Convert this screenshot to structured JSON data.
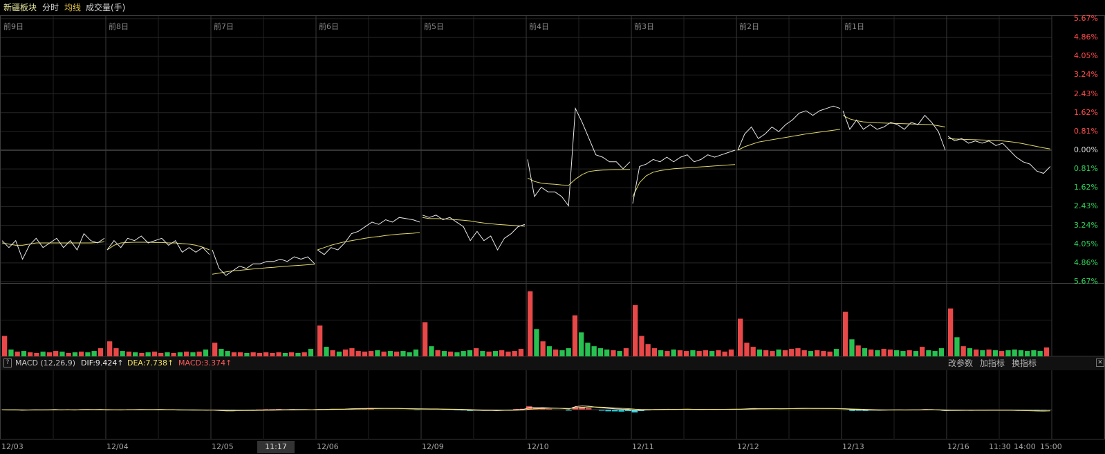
{
  "toolbar": {
    "title": "新疆板块",
    "tab_intraday": "分时",
    "tab_avg": "均线",
    "tab_volume": "成交量(手)"
  },
  "colors": {
    "up": "#ff4b4b",
    "down": "#2fd05a",
    "price_line": "#e8e8e8",
    "avg_line": "#e0d86a",
    "macd_pos": "#ff5a5a",
    "macd_neg": "#22e0f0",
    "dif": "#e8e8e8",
    "dea": "#f0e060"
  },
  "day_labels": [
    "前9日",
    "前8日",
    "前7日",
    "前6日",
    "前5日",
    "前4日",
    "前3日",
    "前2日",
    "前1日"
  ],
  "pct_axis": [
    {
      "label": "5.67%",
      "kind": "up"
    },
    {
      "label": "4.86%",
      "kind": "up"
    },
    {
      "label": "4.05%",
      "kind": "up"
    },
    {
      "label": "3.24%",
      "kind": "up"
    },
    {
      "label": "2.43%",
      "kind": "up"
    },
    {
      "label": "1.62%",
      "kind": "up"
    },
    {
      "label": "0.81%",
      "kind": "up"
    },
    {
      "label": "0.00%",
      "kind": "zero"
    },
    {
      "label": "0.81%",
      "kind": "down"
    },
    {
      "label": "1.62%",
      "kind": "down"
    },
    {
      "label": "2.43%",
      "kind": "down"
    },
    {
      "label": "3.24%",
      "kind": "down"
    },
    {
      "label": "4.05%",
      "kind": "down"
    },
    {
      "label": "4.86%",
      "kind": "down"
    },
    {
      "label": "5.67%",
      "kind": "down"
    }
  ],
  "macd": {
    "name": "MACD (12,26,9)",
    "dif": "DIF:9.424↑",
    "dea": "DEA:7.738↑",
    "macd": "MACD:3.374↑",
    "buttons": [
      "改参数",
      "加指标",
      "换指标"
    ],
    "close_symbol": "✕",
    "help_symbol": "?"
  },
  "time_axis": {
    "dates": [
      "12/03",
      "12/04",
      "12/05",
      "12/06",
      "12/09",
      "12/10",
      "12/11",
      "12/12",
      "12/13",
      "12/16"
    ],
    "tail": [
      "11:30",
      "14:00",
      "15:00"
    ],
    "cursor": "11:17"
  },
  "chart_data": {
    "type": "line",
    "x": [
      "12/03",
      "12/04",
      "12/05",
      "12/06",
      "12/09",
      "12/10",
      "12/11",
      "12/12",
      "12/13",
      "12/16"
    ],
    "y_unit": "% change vs previous close",
    "ylim": [
      -5.67,
      5.67
    ],
    "series": [
      {
        "day": "12/03",
        "price": [
          -3.9,
          -4.2,
          -3.9,
          -4.7,
          -4.1,
          -3.8,
          -4.2,
          -4.0,
          -3.8,
          -4.2,
          -3.9,
          -4.3,
          -3.6,
          -3.9,
          -4.0,
          -3.8
        ],
        "avg": [
          -4.0,
          -4.05,
          -4.1,
          -4.1,
          -4.05,
          -4.0,
          -4.0,
          -4.0,
          -4.0,
          -4.0,
          -4.0,
          -4.0,
          -4.0,
          -4.0,
          -3.98,
          -3.95
        ]
      },
      {
        "day": "12/04",
        "price": [
          -4.3,
          -3.9,
          -4.2,
          -3.8,
          -3.9,
          -3.7,
          -4.0,
          -3.9,
          -3.8,
          -4.1,
          -3.9,
          -4.4,
          -4.2,
          -4.4,
          -4.2,
          -4.5
        ],
        "avg": [
          -4.3,
          -4.1,
          -4.0,
          -3.98,
          -3.97,
          -3.97,
          -3.97,
          -3.98,
          -3.98,
          -4.0,
          -4.0,
          -4.03,
          -4.05,
          -4.1,
          -4.18,
          -4.3
        ]
      },
      {
        "day": "12/05",
        "price": [
          -4.3,
          -5.1,
          -5.4,
          -5.2,
          -5.0,
          -5.1,
          -4.9,
          -4.9,
          -4.8,
          -4.8,
          -4.7,
          -4.8,
          -4.6,
          -4.7,
          -4.6,
          -4.9
        ],
        "avg": [
          -5.35,
          -5.3,
          -5.25,
          -5.2,
          -5.18,
          -5.15,
          -5.12,
          -5.1,
          -5.07,
          -5.05,
          -5.02,
          -5.0,
          -4.98,
          -4.96,
          -4.94,
          -4.92
        ]
      },
      {
        "day": "12/06",
        "price": [
          -4.3,
          -4.5,
          -4.2,
          -4.3,
          -4.0,
          -3.6,
          -3.5,
          -3.3,
          -3.1,
          -3.2,
          -3.0,
          -3.1,
          -2.9,
          -2.95,
          -3.0,
          -3.1
        ],
        "avg": [
          -4.3,
          -4.2,
          -4.1,
          -4.02,
          -3.95,
          -3.9,
          -3.85,
          -3.8,
          -3.75,
          -3.72,
          -3.68,
          -3.65,
          -3.62,
          -3.6,
          -3.58,
          -3.55
        ]
      },
      {
        "day": "12/09",
        "price": [
          -2.8,
          -2.9,
          -2.8,
          -3.0,
          -2.9,
          -3.1,
          -3.3,
          -3.9,
          -3.5,
          -3.9,
          -3.7,
          -4.3,
          -3.8,
          -3.6,
          -3.3,
          -3.2
        ],
        "avg": [
          -2.9,
          -2.95,
          -2.95,
          -2.96,
          -2.98,
          -3.0,
          -3.02,
          -3.05,
          -3.1,
          -3.14,
          -3.17,
          -3.2,
          -3.22,
          -3.24,
          -3.26,
          -3.28
        ]
      },
      {
        "day": "12/10",
        "price": [
          -0.4,
          -2.0,
          -1.6,
          -1.8,
          -1.8,
          -2.0,
          -2.4,
          1.8,
          1.2,
          0.5,
          -0.2,
          -0.3,
          -0.5,
          -0.5,
          -0.8,
          -0.5
        ],
        "avg": [
          -1.2,
          -1.35,
          -1.42,
          -1.45,
          -1.47,
          -1.5,
          -1.52,
          -1.25,
          -1.05,
          -0.92,
          -0.88,
          -0.86,
          -0.85,
          -0.84,
          -0.84,
          -0.83
        ]
      },
      {
        "day": "12/11",
        "price": [
          -2.3,
          -0.7,
          -0.6,
          -0.4,
          -0.5,
          -0.3,
          -0.5,
          -0.3,
          -0.2,
          -0.5,
          -0.4,
          -0.2,
          -0.3,
          -0.2,
          -0.1,
          0.0
        ],
        "avg": [
          -2.0,
          -1.4,
          -1.1,
          -0.95,
          -0.88,
          -0.84,
          -0.8,
          -0.78,
          -0.76,
          -0.74,
          -0.72,
          -0.7,
          -0.68,
          -0.66,
          -0.64,
          -0.62
        ]
      },
      {
        "day": "12/12",
        "price": [
          0.0,
          0.7,
          1.0,
          0.5,
          0.7,
          1.0,
          0.8,
          1.1,
          1.3,
          1.6,
          1.7,
          1.5,
          1.7,
          1.8,
          1.9,
          1.8
        ],
        "avg": [
          0.0,
          0.15,
          0.25,
          0.35,
          0.4,
          0.45,
          0.5,
          0.55,
          0.6,
          0.65,
          0.7,
          0.74,
          0.78,
          0.82,
          0.86,
          0.9
        ]
      },
      {
        "day": "12/13",
        "price": [
          1.7,
          0.9,
          1.3,
          0.9,
          1.1,
          0.9,
          1.0,
          1.2,
          1.1,
          0.9,
          1.2,
          1.1,
          1.5,
          1.2,
          0.8,
          0.0
        ],
        "avg": [
          1.5,
          1.35,
          1.27,
          1.22,
          1.2,
          1.18,
          1.17,
          1.16,
          1.15,
          1.14,
          1.13,
          1.12,
          1.11,
          1.1,
          1.05,
          1.0
        ]
      },
      {
        "day": "12/16",
        "price": [
          0.6,
          0.4,
          0.5,
          0.3,
          0.4,
          0.3,
          0.4,
          0.2,
          0.3,
          0.0,
          -0.3,
          -0.5,
          -0.6,
          -0.9,
          -1.0,
          -0.7
        ],
        "avg": [
          0.5,
          0.48,
          0.47,
          0.46,
          0.45,
          0.44,
          0.43,
          0.42,
          0.4,
          0.37,
          0.33,
          0.28,
          0.22,
          0.16,
          0.1,
          0.05
        ]
      }
    ],
    "volume": [
      [
        30,
        10,
        7,
        8,
        6,
        5,
        7,
        6,
        8,
        7,
        5,
        6,
        7,
        6,
        8,
        12
      ],
      [
        22,
        12,
        8,
        7,
        6,
        5,
        6,
        7,
        5,
        6,
        5,
        6,
        7,
        6,
        7,
        10
      ],
      [
        20,
        11,
        8,
        6,
        6,
        5,
        6,
        5,
        6,
        5,
        6,
        5,
        6,
        5,
        6,
        11
      ],
      [
        45,
        14,
        9,
        7,
        10,
        12,
        8,
        7,
        8,
        9,
        7,
        8,
        7,
        8,
        6,
        10
      ],
      [
        50,
        15,
        9,
        8,
        7,
        6,
        8,
        9,
        12,
        8,
        7,
        8,
        9,
        7,
        8,
        11
      ],
      [
        95,
        40,
        22,
        15,
        10,
        9,
        12,
        60,
        35,
        20,
        15,
        12,
        10,
        9,
        8,
        12
      ],
      [
        75,
        30,
        18,
        12,
        9,
        8,
        10,
        9,
        8,
        9,
        8,
        9,
        8,
        9,
        7,
        10
      ],
      [
        55,
        20,
        14,
        10,
        9,
        8,
        10,
        9,
        11,
        12,
        9,
        8,
        9,
        8,
        7,
        11
      ],
      [
        65,
        25,
        16,
        12,
        10,
        9,
        11,
        10,
        9,
        8,
        9,
        8,
        14,
        9,
        8,
        12
      ],
      [
        70,
        28,
        15,
        12,
        10,
        9,
        10,
        9,
        8,
        9,
        10,
        9,
        8,
        9,
        8,
        13
      ]
    ],
    "macd_indicator": {
      "dif": 9.424,
      "dea": 7.738,
      "macd": 3.374
    }
  }
}
